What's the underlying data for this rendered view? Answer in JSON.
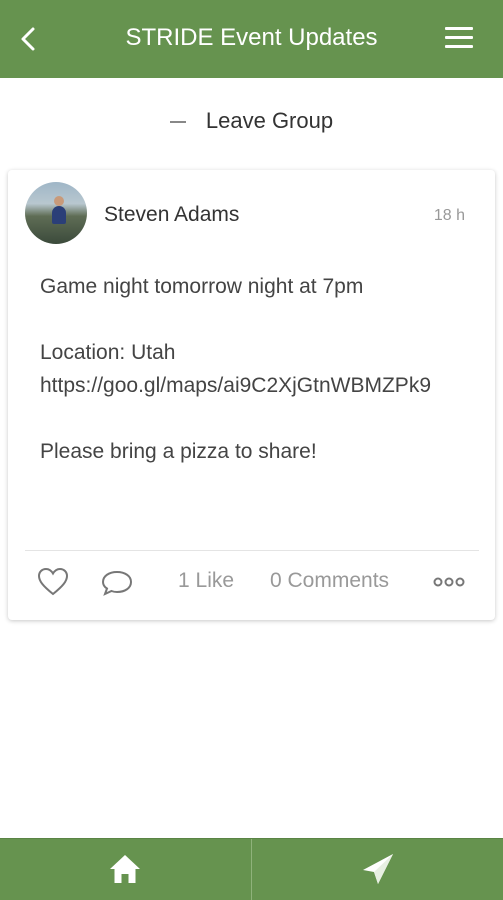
{
  "header": {
    "title": "STRIDE Event Updates",
    "back_icon": "chevron-left-icon",
    "menu_icon": "hamburger-menu-icon"
  },
  "group_action": {
    "label": "Leave Group",
    "icon": "minus-icon"
  },
  "post": {
    "author": "Steven Adams",
    "time": "18 h",
    "body": "Game night tomorrow night at 7pm\n\nLocation: Utah\nhttps://goo.gl/maps/ai9C2XjGtnWBMZPk9\n\nPlease bring a pizza to share!",
    "likes_label": "1 Like",
    "comments_label": "0 Comments",
    "icons": {
      "like": "heart-icon",
      "comment": "speech-bubble-icon",
      "more": "more-dots-icon"
    }
  },
  "bottom_nav": {
    "items": [
      {
        "icon": "home-icon"
      },
      {
        "icon": "send-icon"
      }
    ]
  },
  "colors": {
    "brand_green": "#66934f",
    "text": "#444444",
    "muted": "#999999"
  }
}
